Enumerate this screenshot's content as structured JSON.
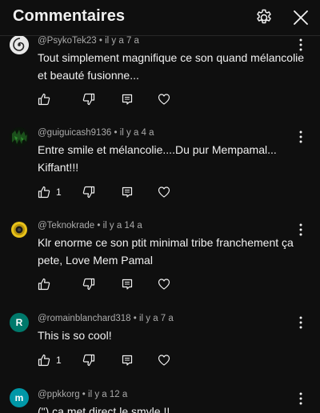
{
  "header": {
    "title": "Commentaires",
    "settings_icon": "gear-icon",
    "close_icon": "close-icon"
  },
  "comments": [
    {
      "author": "@PsykoTek23",
      "time": "il y a 7 a",
      "text": "Tout simplement magnifique ce son quand mélancolie et beauté fusionne...",
      "likes": "",
      "avatar": {
        "type": "spiral",
        "bg": "#e8e8e8"
      }
    },
    {
      "author": "@guiguicash9136",
      "time": "il y a 4 a",
      "text": "Entre smile et mélancolie....Du pur Mempamal... Kiffant!!!",
      "likes": "1",
      "avatar": {
        "type": "dark",
        "bg": "#0b1a0b"
      }
    },
    {
      "author": "@Teknokrade",
      "time": "il y a 14 a",
      "text": "Klr enorme ce son ptit minimal tribe franchement ça pete, Love Mem Pamal",
      "likes": "",
      "avatar": {
        "type": "speaker",
        "bg": "#1a1a1a"
      }
    },
    {
      "author": "@romainblanchard318",
      "time": "il y a 7 a",
      "text": "This is so cool!",
      "likes": "1",
      "avatar": {
        "type": "letter",
        "letter": "R",
        "bg": "#00796b"
      }
    },
    {
      "author": "@ppkkorg",
      "time": "il y a 12 a",
      "text": "(\") ça met direct le smyle !!",
      "likes": "",
      "avatar": {
        "type": "letter",
        "letter": "m",
        "bg": "#0097a7"
      }
    }
  ]
}
